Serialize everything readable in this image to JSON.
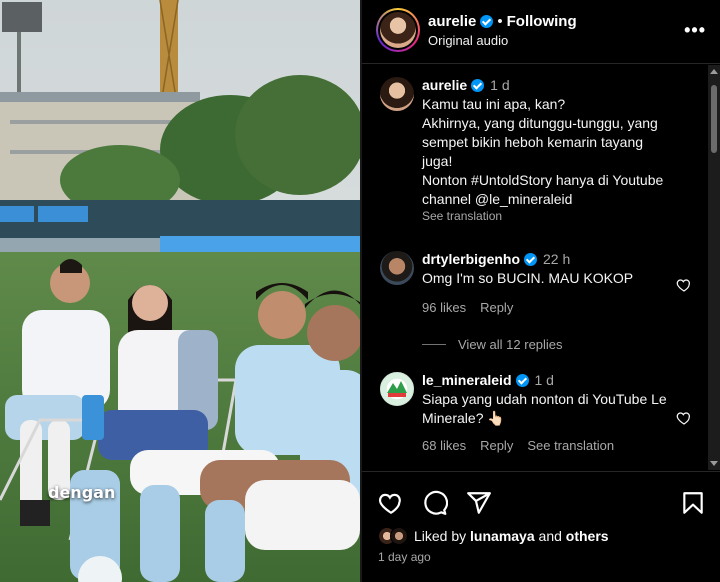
{
  "video": {
    "overlay_caption": "dengan"
  },
  "header": {
    "username": "aurelie",
    "separator": "•",
    "follow_label": "Following",
    "audio_label": "Original audio",
    "more_label": "•••"
  },
  "caption": {
    "username": "aurelie",
    "time": "1 d",
    "text": "Kamu tau ini apa, kan?\nAkhirnya, yang ditunggu-tunggu, yang sempet bikin heboh kemarin tayang juga!\nNonton #UntoldStory hanya di Youtube channel @le_mineraleid",
    "see_translation": "See translation"
  },
  "comments": [
    {
      "username": "drtylerbigenho",
      "time": "22 h",
      "text": "Omg I'm so BUCIN. MAU KOKOP",
      "likes": "96 likes",
      "reply_label": "Reply",
      "view_replies": "View all 12 replies"
    },
    {
      "username": "le_mineraleid",
      "time": "1 d",
      "text": "Siapa yang udah nonton di YouTube Le Minerale? 👆🏻",
      "likes": "68 likes",
      "reply_label": "Reply",
      "see_translation": "See translation"
    }
  ],
  "footer": {
    "liked_prefix": "Liked by",
    "liked_user": "lunamaya",
    "liked_and": "and",
    "liked_others": "others",
    "post_age": "1 day ago"
  },
  "icons": [
    "heart-icon",
    "comment-icon",
    "share-icon",
    "bookmark-icon",
    "more-icon",
    "verified-icon"
  ],
  "colors": {
    "background": "#000000",
    "verified": "#0095f6",
    "muted_text": "#a8a8a8",
    "divider": "#262626"
  }
}
